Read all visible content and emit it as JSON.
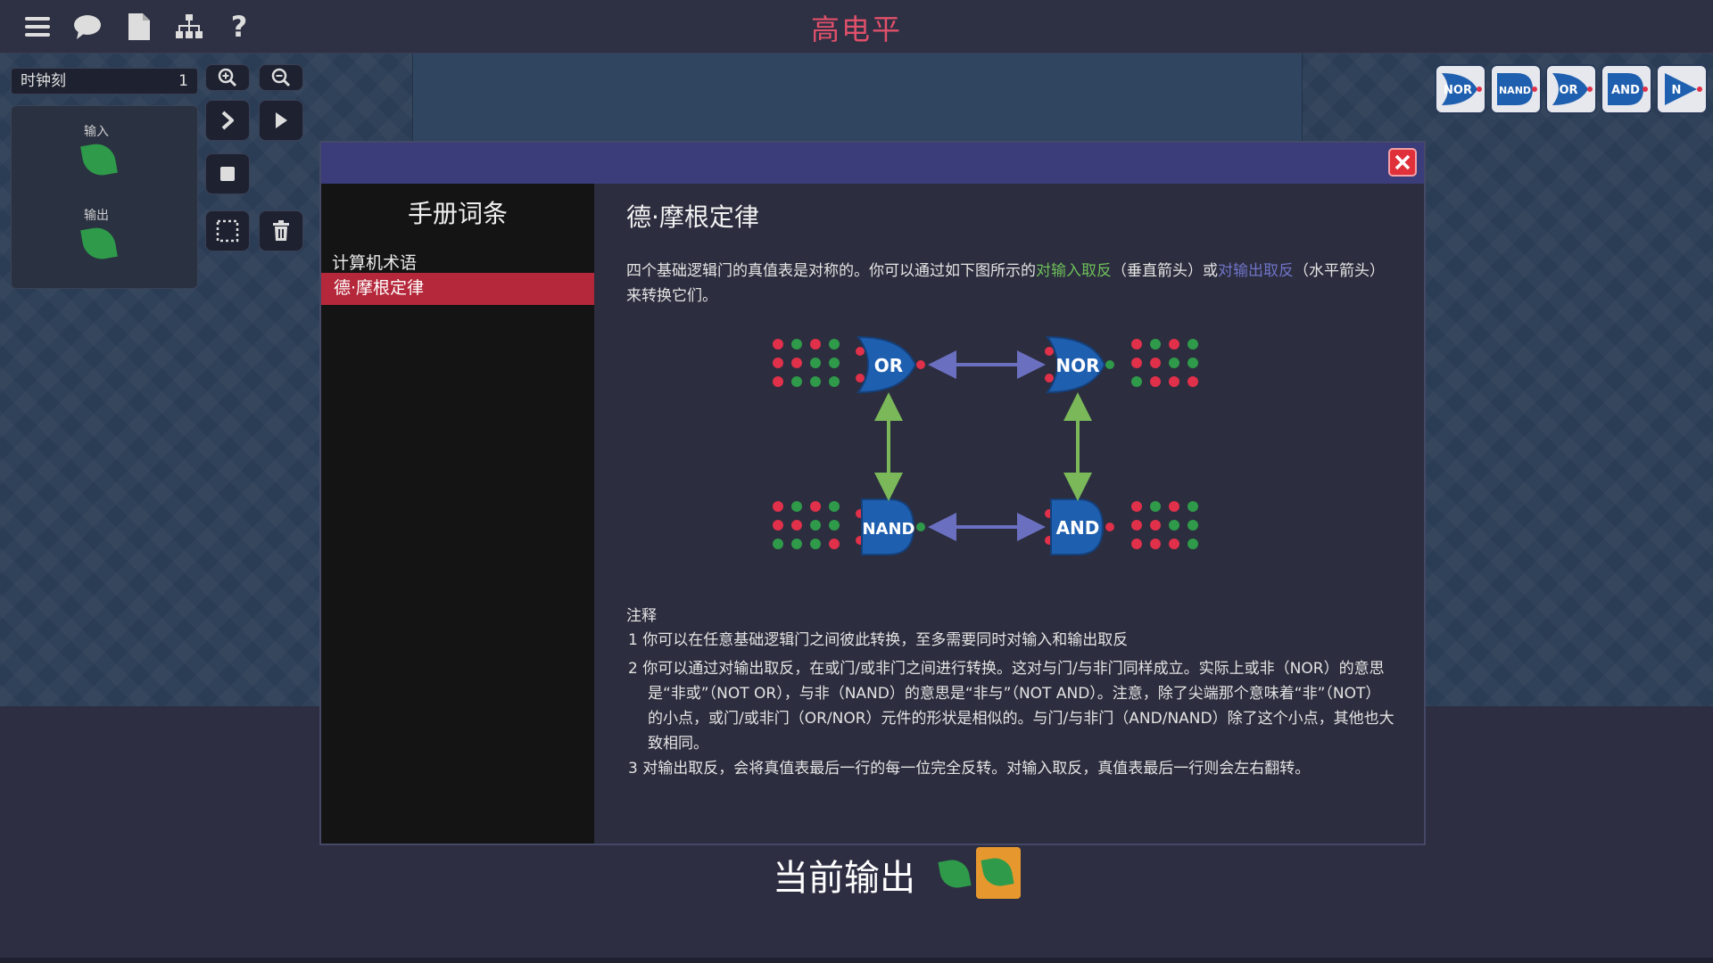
{
  "topbar": {
    "title": "高电平",
    "icons": [
      "menu-icon",
      "chat-icon",
      "document-icon",
      "hierarchy-icon",
      "help-icon"
    ]
  },
  "sim": {
    "clock_label": "时钟刻",
    "clock_value": "1",
    "input_label": "输入",
    "output_label": "输出"
  },
  "toolbar": {
    "buttons": [
      "zoom-in-icon",
      "zoom-out-icon",
      "step-icon",
      "play-icon",
      "stop-icon",
      "select-icon",
      "trash-icon"
    ]
  },
  "gate_palette": [
    "NOR",
    "NAND",
    "OR",
    "AND",
    "N"
  ],
  "manual": {
    "side_title": "手册词条",
    "category": "计算机术语",
    "selected_entry": "德·摩根定律",
    "title": "德·摩根定律",
    "intro_before": "四个基础逻辑门的真值表是对称的。你可以通过如下图所示的",
    "intro_link_input": "对输入取反",
    "intro_mid": "（垂直箭头）或",
    "intro_link_output": "对输出取反",
    "intro_after": "（水平箭头）来转换它们。",
    "diagram": {
      "gate_or": "OR",
      "gate_nor": "NOR",
      "gate_nand": "NAND",
      "gate_and": "AND"
    },
    "notes_heading": "注释",
    "notes": [
      "1 你可以在任意基础逻辑门之间彼此转换，至多需要同时对输入和输出取反",
      "2 你可以通过对输出取反，在或门/或非门之间进行转换。这对与门/与非门同样成立。实际上或非（NOR）的意思是“非或”（NOT OR），与非（NAND）的意思是“非与”（NOT AND）。注意，除了尖端那个意味着“非”（NOT）的小点，或门/或非门（OR/NOR）元件的形状是相似的。与门/与非门（AND/NAND）除了这个小点，其他也大致相同。",
      "3 对输出取反，会将真值表最后一行的每一位完全反转。对输入取反，真值表最后一行则会左右翻转。"
    ]
  },
  "footer": {
    "current_output_label": "当前输出"
  },
  "colors": {
    "title_red": "#e0506a",
    "input_link_green": "#6dbf5a",
    "output_link_blue": "#6f74c8",
    "selected_red": "#b5283b",
    "modal_header": "#3a3d7a",
    "gate_blue": "#1f5fb0",
    "on_green": "#2e9a4a",
    "off_red": "#e0304a",
    "arrow_green": "#7ab85a",
    "arrow_purple": "#6a6fc0",
    "output_box": "#e6982e"
  }
}
